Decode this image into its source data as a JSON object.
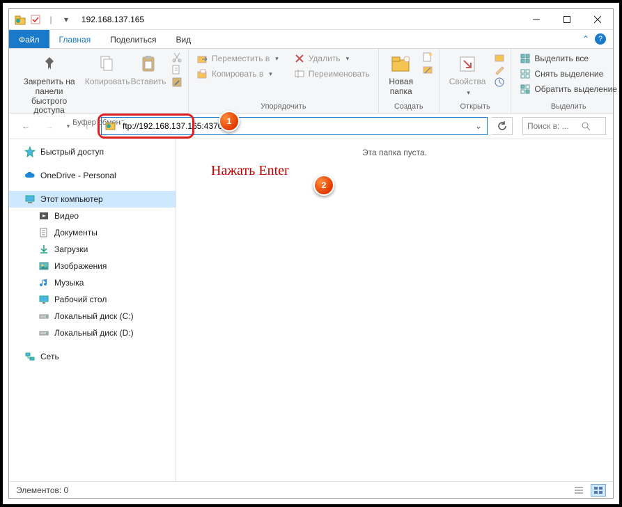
{
  "title": "192.168.137.165",
  "tabs": {
    "file": "Файл",
    "home": "Главная",
    "share": "Поделиться",
    "view": "Вид"
  },
  "ribbon": {
    "pin": "Закрепить на панели\nбыстрого доступа",
    "copy": "Копировать",
    "paste": "Вставить",
    "clipboard_label": "Буфер обмена",
    "move_to": "Переместить в",
    "copy_to": "Копировать в",
    "delete": "Удалить",
    "rename": "Переименовать",
    "organize_label": "Упорядочить",
    "new_folder": "Новая\nпапка",
    "new_label": "Создать",
    "properties": "Свойства",
    "open_label": "Открыть",
    "select_all": "Выделить все",
    "select_none": "Снять выделение",
    "select_invert": "Обратить выделение",
    "select_label": "Выделить"
  },
  "address": {
    "value": "ftp://192.168.137.165:4370/"
  },
  "search": {
    "placeholder": "Поиск в: ..."
  },
  "sidebar": {
    "quick": "Быстрый доступ",
    "onedrive": "OneDrive - Personal",
    "thispc": "Этот компьютер",
    "videos": "Видео",
    "documents": "Документы",
    "downloads": "Загрузки",
    "pictures": "Изображения",
    "music": "Музыка",
    "desktop": "Рабочий стол",
    "disk_c": "Локальный диск (C:)",
    "disk_d": "Локальный диск (D:)",
    "network": "Сеть"
  },
  "main": {
    "empty": "Эта папка пуста."
  },
  "annotation": {
    "text": "Нажать Enter",
    "badge1": "1",
    "badge2": "2"
  },
  "status": {
    "elements": "Элементов: 0"
  }
}
